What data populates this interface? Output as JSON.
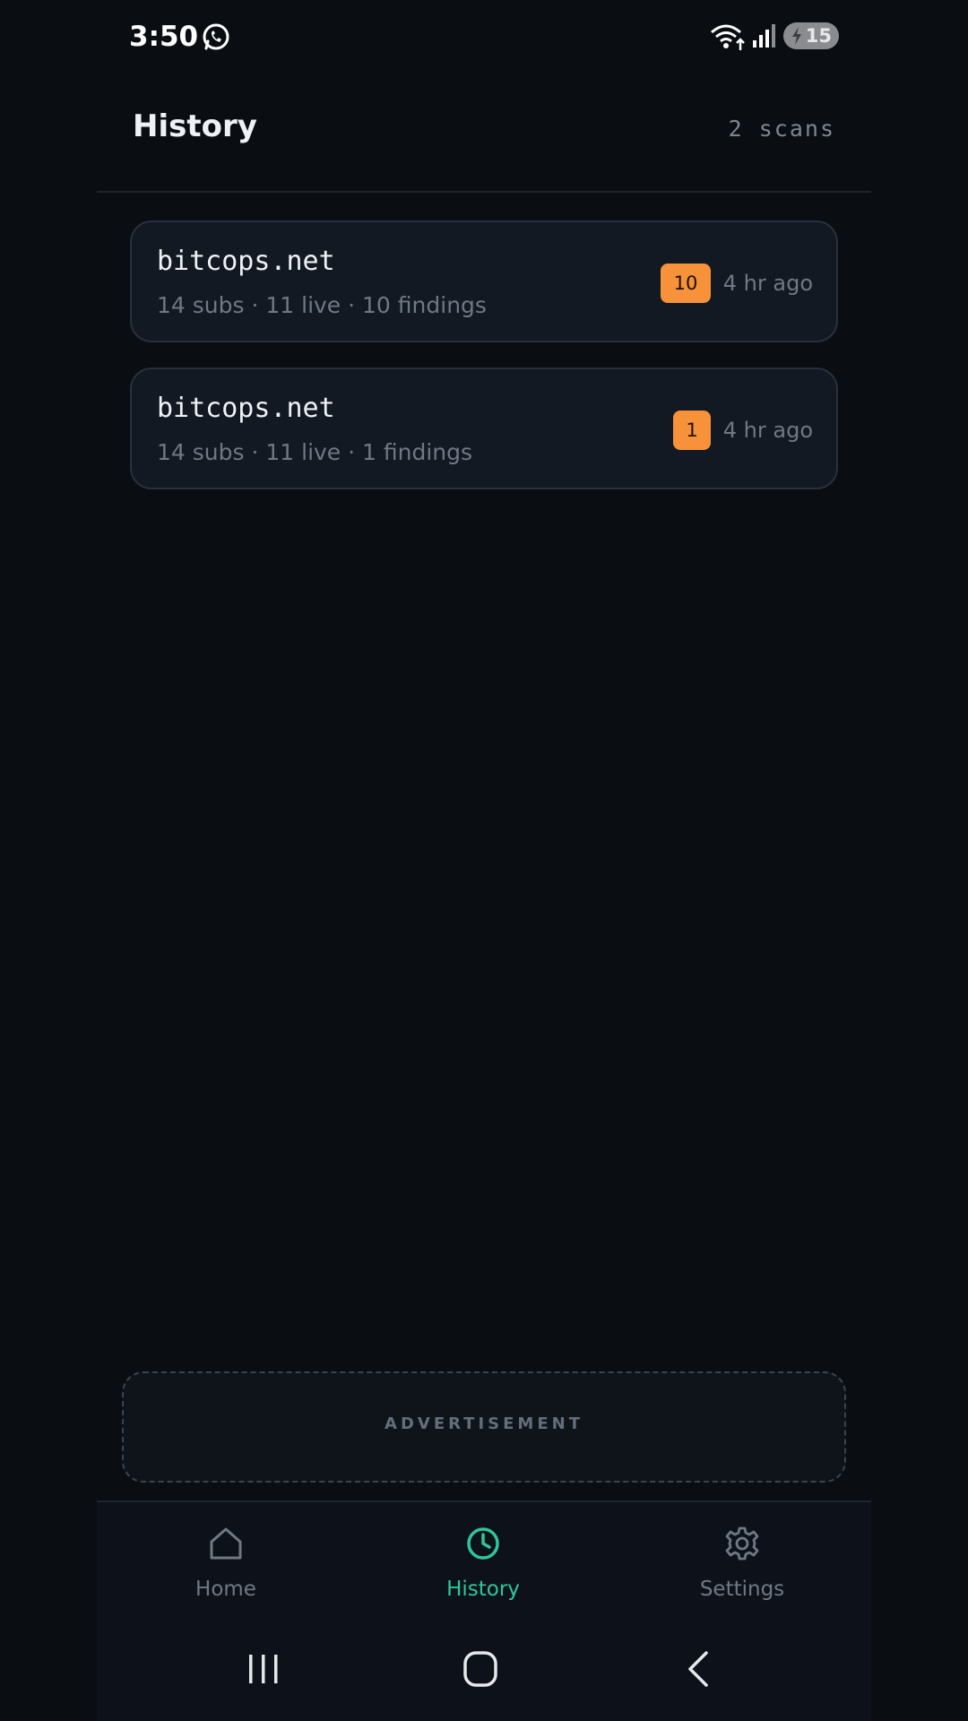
{
  "status_bar": {
    "time": "3:50",
    "battery_level": "15",
    "icons": [
      "whatsapp-icon",
      "wifi-icon",
      "signal-icon",
      "battery-icon"
    ]
  },
  "header": {
    "title": "History",
    "scan_count": "2 scans"
  },
  "scans": [
    {
      "domain": "bitcops.net",
      "meta": "14 subs · 11 live · 10 findings",
      "badge": "10",
      "time": "4 hr ago"
    },
    {
      "domain": "bitcops.net",
      "meta": "14 subs · 11 live · 1 findings",
      "badge": "1",
      "time": "4 hr ago"
    }
  ],
  "advertisement": {
    "label": "ADVERTISEMENT"
  },
  "bottom_nav": {
    "items": [
      {
        "label": "Home",
        "icon": "home-icon",
        "active": false
      },
      {
        "label": "History",
        "icon": "clock-icon",
        "active": true
      },
      {
        "label": "Settings",
        "icon": "gear-icon",
        "active": false
      }
    ]
  },
  "system_nav": {
    "buttons": [
      "recents-button",
      "home-button",
      "back-button"
    ]
  },
  "colors": {
    "background": "#0a0d12",
    "card": "#131922",
    "badge": "#f7923b",
    "accent": "#2ec79a",
    "muted": "#6f7884"
  }
}
